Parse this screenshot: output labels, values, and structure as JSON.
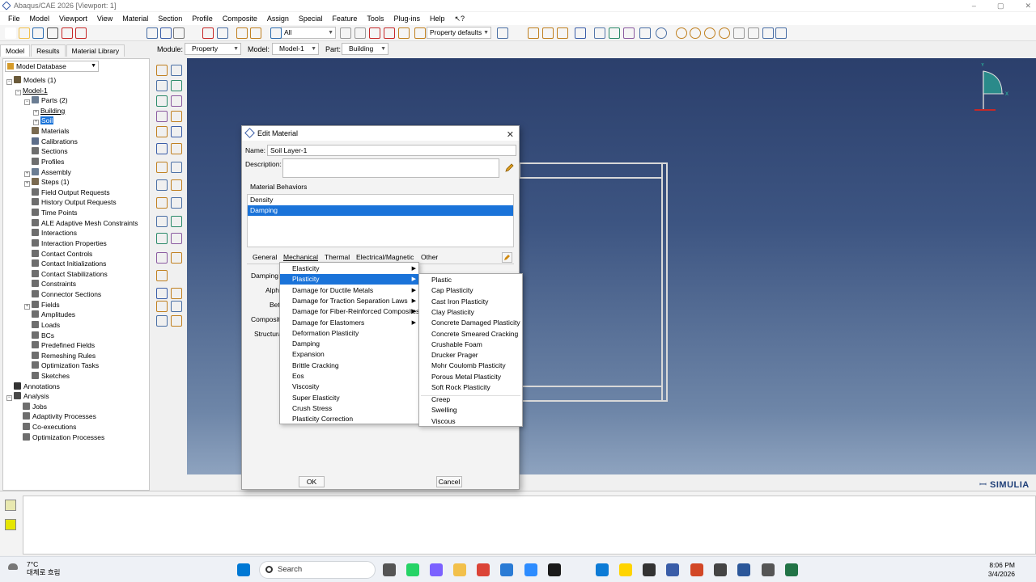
{
  "window": {
    "title": "Abaqus/CAE 2026 [Viewport: 1]",
    "min": "–",
    "max": "▢",
    "close": "✕"
  },
  "menu": [
    "File",
    "Model",
    "Viewport",
    "View",
    "Material",
    "Section",
    "Profile",
    "Composite",
    "Assign",
    "Special",
    "Feature",
    "Tools",
    "Plug-ins",
    "Help",
    "↖?"
  ],
  "toolbar": {
    "selection_filter": "All",
    "property_defaults": "Property defaults"
  },
  "context": {
    "module_label": "Module:",
    "module": "Property",
    "model_label": "Model:",
    "model": "Model-1",
    "part_label": "Part:",
    "part": "Building"
  },
  "tabs": [
    "Model",
    "Results",
    "Material Library"
  ],
  "tree": {
    "header": "Model Database",
    "nodes": [
      {
        "label": "Models (1)",
        "indent": 0,
        "exp": "−",
        "color": "#6a5a3a"
      },
      {
        "label": "Model-1",
        "indent": 1,
        "exp": "−",
        "color": "",
        "underline": true
      },
      {
        "label": "Parts (2)",
        "indent": 2,
        "exp": "−",
        "color": "#6b7d93"
      },
      {
        "label": "Building",
        "indent": 3,
        "exp": "+",
        "color": "",
        "underline": true
      },
      {
        "label": "Soil",
        "indent": 3,
        "exp": "+",
        "color": "",
        "highlight": true
      },
      {
        "label": "Materials",
        "indent": 2,
        "exp": "",
        "color": "#7a6a50"
      },
      {
        "label": "Calibrations",
        "indent": 2,
        "exp": "",
        "color": "#5d6e8a"
      },
      {
        "label": "Sections",
        "indent": 2,
        "exp": "",
        "color": "#6e6e6e"
      },
      {
        "label": "Profiles",
        "indent": 2,
        "exp": "",
        "color": "#6e6e6e"
      },
      {
        "label": "Assembly",
        "indent": 2,
        "exp": "+",
        "color": "#6b7d93"
      },
      {
        "label": "Steps (1)",
        "indent": 2,
        "exp": "+",
        "color": "#7a6a50"
      },
      {
        "label": "Field Output Requests",
        "indent": 2,
        "exp": "",
        "color": "#6e6e6e"
      },
      {
        "label": "History Output Requests",
        "indent": 2,
        "exp": "",
        "color": "#6e6e6e"
      },
      {
        "label": "Time Points",
        "indent": 2,
        "exp": "",
        "color": "#6e6e6e"
      },
      {
        "label": "ALE Adaptive Mesh Constraints",
        "indent": 2,
        "exp": "",
        "color": "#6e6e6e"
      },
      {
        "label": "Interactions",
        "indent": 2,
        "exp": "",
        "color": "#6e6e6e"
      },
      {
        "label": "Interaction Properties",
        "indent": 2,
        "exp": "",
        "color": "#6e6e6e"
      },
      {
        "label": "Contact Controls",
        "indent": 2,
        "exp": "",
        "color": "#6e6e6e"
      },
      {
        "label": "Contact Initializations",
        "indent": 2,
        "exp": "",
        "color": "#6e6e6e"
      },
      {
        "label": "Contact Stabilizations",
        "indent": 2,
        "exp": "",
        "color": "#6e6e6e"
      },
      {
        "label": "Constraints",
        "indent": 2,
        "exp": "",
        "color": "#6e6e6e"
      },
      {
        "label": "Connector Sections",
        "indent": 2,
        "exp": "",
        "color": "#6e6e6e"
      },
      {
        "label": "Fields",
        "indent": 2,
        "exp": "+",
        "color": "#6e6e6e"
      },
      {
        "label": "Amplitudes",
        "indent": 2,
        "exp": "",
        "color": "#6e6e6e"
      },
      {
        "label": "Loads",
        "indent": 2,
        "exp": "",
        "color": "#6e6e6e"
      },
      {
        "label": "BCs",
        "indent": 2,
        "exp": "",
        "color": "#6e6e6e"
      },
      {
        "label": "Predefined Fields",
        "indent": 2,
        "exp": "",
        "color": "#6e6e6e"
      },
      {
        "label": "Remeshing Rules",
        "indent": 2,
        "exp": "",
        "color": "#6e6e6e"
      },
      {
        "label": "Optimization Tasks",
        "indent": 2,
        "exp": "",
        "color": "#6e6e6e"
      },
      {
        "label": "Sketches",
        "indent": 2,
        "exp": "",
        "color": "#6e6e6e"
      },
      {
        "label": "Annotations",
        "indent": 0,
        "exp": "",
        "color": "#333333"
      },
      {
        "label": "Analysis",
        "indent": 0,
        "exp": "−",
        "color": "#4a4a4a"
      },
      {
        "label": "Jobs",
        "indent": 1,
        "exp": "",
        "color": "#6e6e6e"
      },
      {
        "label": "Adaptivity Processes",
        "indent": 1,
        "exp": "",
        "color": "#6e6e6e"
      },
      {
        "label": "Co-executions",
        "indent": 1,
        "exp": "",
        "color": "#6e6e6e"
      },
      {
        "label": "Optimization Processes",
        "indent": 1,
        "exp": "",
        "color": "#6e6e6e"
      }
    ]
  },
  "dialog": {
    "title": "Edit Material",
    "close": "✕",
    "name_label": "Name:",
    "name_value": "Soil Layer-1",
    "desc_label": "Description:",
    "desc_value": "",
    "behaviors_label": "Material Behaviors",
    "behaviors": [
      "Density",
      "Damping"
    ],
    "behavior_selected": "Damping",
    "tabs": [
      "General",
      "Mechanical",
      "Thermal",
      "Electrical/Magnetic",
      "Other"
    ],
    "sub_labels": [
      "Damping",
      "Alph",
      "Bet",
      "Composit",
      "Structura"
    ],
    "ok": "OK",
    "cancel": "Cancel"
  },
  "mechanical_menu": [
    {
      "label": "Elasticity",
      "sub": true
    },
    {
      "label": "Plasticity",
      "sub": true,
      "selected": true
    },
    {
      "label": "Damage for Ductile Metals",
      "sub": true
    },
    {
      "label": "Damage for Traction Separation Laws",
      "sub": true
    },
    {
      "label": "Damage for Fiber-Reinforced Composites",
      "sub": true
    },
    {
      "label": "Damage for Elastomers",
      "sub": true
    },
    {
      "label": "Deformation Plasticity",
      "sub": false
    },
    {
      "label": "Damping",
      "sub": false
    },
    {
      "label": "Expansion",
      "sub": false
    },
    {
      "label": "Brittle Cracking",
      "sub": false
    },
    {
      "label": "Eos",
      "sub": false
    },
    {
      "label": "Viscosity",
      "sub": false
    },
    {
      "label": "Super Elasticity",
      "sub": false
    },
    {
      "label": "Crush Stress",
      "sub": false
    },
    {
      "label": "Plasticity Correction",
      "sub": false
    }
  ],
  "plasticity_menu": [
    "Plastic",
    "Cap Plasticity",
    "Cast Iron Plasticity",
    "Clay Plasticity",
    "Concrete Damaged Plasticity",
    "Concrete Smeared Cracking",
    "Crushable Foam",
    "Drucker Prager",
    "Mohr Coulomb Plasticity",
    "Porous Metal Plasticity",
    "Soft Rock Plasticity"
  ],
  "plasticity_menu2": [
    "Creep",
    "Swelling",
    "Viscous"
  ],
  "viewport": {
    "brand": "SIMULIA",
    "axis_y": "Y",
    "axis_x": "X"
  },
  "taskbar": {
    "temp": "7°C",
    "weather": "대체로 흐림",
    "search": "Search",
    "time": "8:06 PM",
    "date": "3/4/2026"
  },
  "colors": {
    "accent": "#1a73d9",
    "viewport_top": "#2b3f6c",
    "viewport_bottom": "#8ea3bf"
  }
}
